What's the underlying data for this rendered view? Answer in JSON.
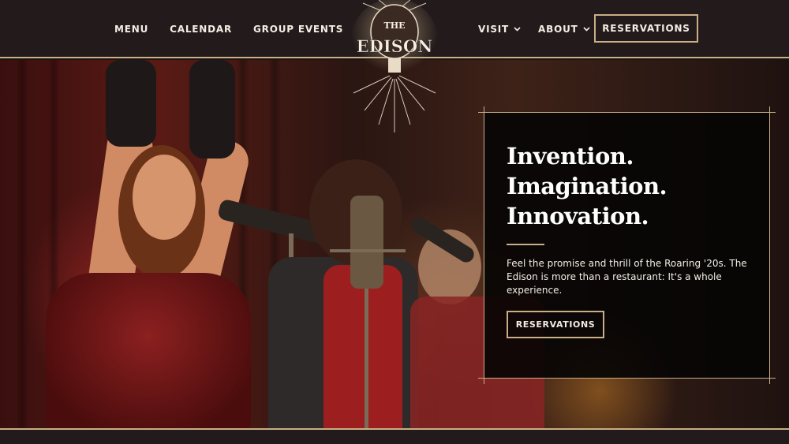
{
  "header": {
    "nav_left": [
      {
        "label": "MENU"
      },
      {
        "label": "CALENDAR"
      },
      {
        "label": "GROUP EVENTS"
      }
    ],
    "nav_right": [
      {
        "label": "VISIT",
        "icon": "chevron-down-icon"
      },
      {
        "label": "ABOUT",
        "icon": "chevron-down-icon"
      }
    ],
    "reservations_label": "RESERVATIONS"
  },
  "logo": {
    "line1": "THE",
    "line2": "EDISON"
  },
  "hero": {
    "title_lines": [
      "Invention.",
      "Imagination.",
      "Innovation."
    ],
    "body": "Feel the promise and thrill of the Roaring '20s. The Edison is more than a restaurant: It's a whole experience.",
    "cta_label": "RESERVATIONS"
  },
  "colors": {
    "accent": "#c9ae86",
    "header_bg": "#231b1b",
    "card_bg": "#060404"
  }
}
